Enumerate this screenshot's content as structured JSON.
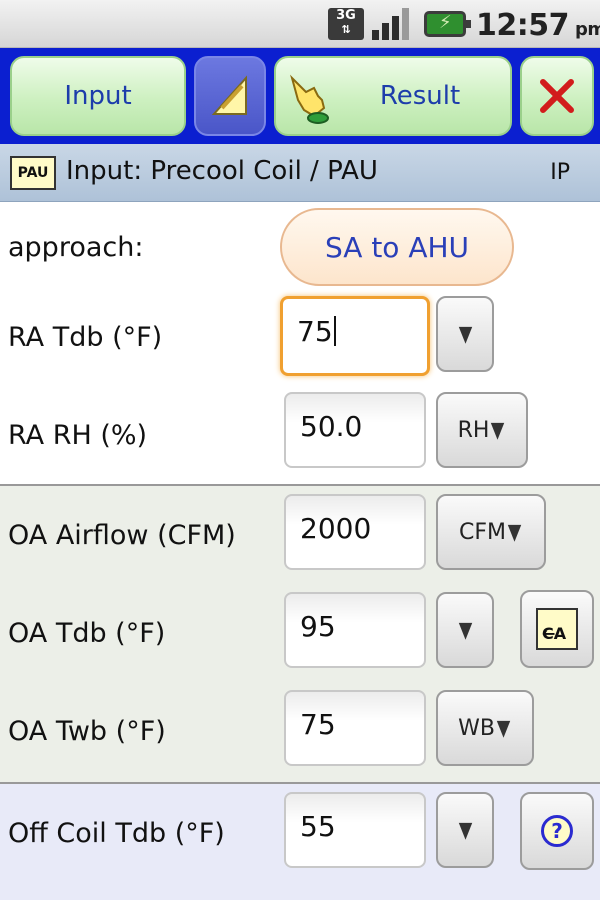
{
  "status_bar": {
    "network": "3G",
    "time": "12:57",
    "ampm": "pm"
  },
  "toolbar": {
    "input_label": "Input",
    "result_label": "Result"
  },
  "header": {
    "icon_text": "PAU",
    "title": "Input: Precool Coil / PAU",
    "units": "IP"
  },
  "form": {
    "approach": {
      "label": "approach:",
      "value": "SA to AHU"
    },
    "ra_tdb": {
      "label": "RA Tdb (°F)",
      "value": "75"
    },
    "ra_rh": {
      "label": "RA RH (%)",
      "value": "50.0",
      "unit_button": "RH"
    },
    "oa_airflow": {
      "label": "OA Airflow (CFM)",
      "value": "2000",
      "unit_button": "CFM"
    },
    "oa_tdb": {
      "label": "OA Tdb (°F)",
      "value": "95",
      "ca_icon": "CA"
    },
    "oa_twb": {
      "label": "OA Twb (°F)",
      "value": "75",
      "unit_button": "WB"
    },
    "off_coil_tdb": {
      "label": "Off Coil Tdb (°F)",
      "value": "55",
      "help_icon": "?"
    }
  },
  "dropdown_glyph": "▼"
}
